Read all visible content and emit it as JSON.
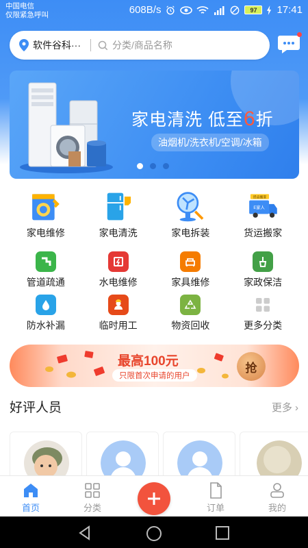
{
  "status_bar": {
    "carrier_line1": "中国电信",
    "carrier_line2": "仅限紧急呼叫",
    "net_speed": "608B/s",
    "battery": "97",
    "time": "17:41"
  },
  "header": {
    "location": "软件谷科···",
    "search_placeholder": "分类/商品名称",
    "accent_color": "#3d8df5"
  },
  "banner": {
    "title_prefix": "家电清洗  低至",
    "title_highlight": "6",
    "title_suffix": "折",
    "subtitle": "油烟机/洗衣机/空调/冰箱",
    "active_slide": 1,
    "slide_count": 3
  },
  "services": [
    {
      "label": "家电维修",
      "icon": "appliance-repair-icon"
    },
    {
      "label": "家电清洗",
      "icon": "appliance-clean-icon"
    },
    {
      "label": "家电拆装",
      "icon": "appliance-install-icon"
    },
    {
      "label": "货运搬家",
      "icon": "moving-truck-icon"
    },
    {
      "label": "管道疏通",
      "icon": "pipe-icon"
    },
    {
      "label": "水电维修",
      "icon": "electric-repair-icon"
    },
    {
      "label": "家具维修",
      "icon": "furniture-repair-icon"
    },
    {
      "label": "家政保洁",
      "icon": "housekeeping-icon"
    },
    {
      "label": "防水补漏",
      "icon": "waterproof-icon"
    },
    {
      "label": "临时用工",
      "icon": "worker-icon"
    },
    {
      "label": "物资回收",
      "icon": "recycle-icon"
    },
    {
      "label": "更多分类",
      "icon": "more-categories-icon"
    }
  ],
  "truck_badge": "货运搬家",
  "truck_text": "E家人",
  "promo": {
    "title": "最高100元",
    "subtitle": "只限首次申请的用户",
    "button": "抢"
  },
  "section": {
    "title": "好评人员",
    "more": "更多"
  },
  "tabs": [
    {
      "label": "首页",
      "active": true
    },
    {
      "label": "分类",
      "active": false
    },
    {
      "label": "订单",
      "active": false
    },
    {
      "label": "我的",
      "active": false
    }
  ]
}
